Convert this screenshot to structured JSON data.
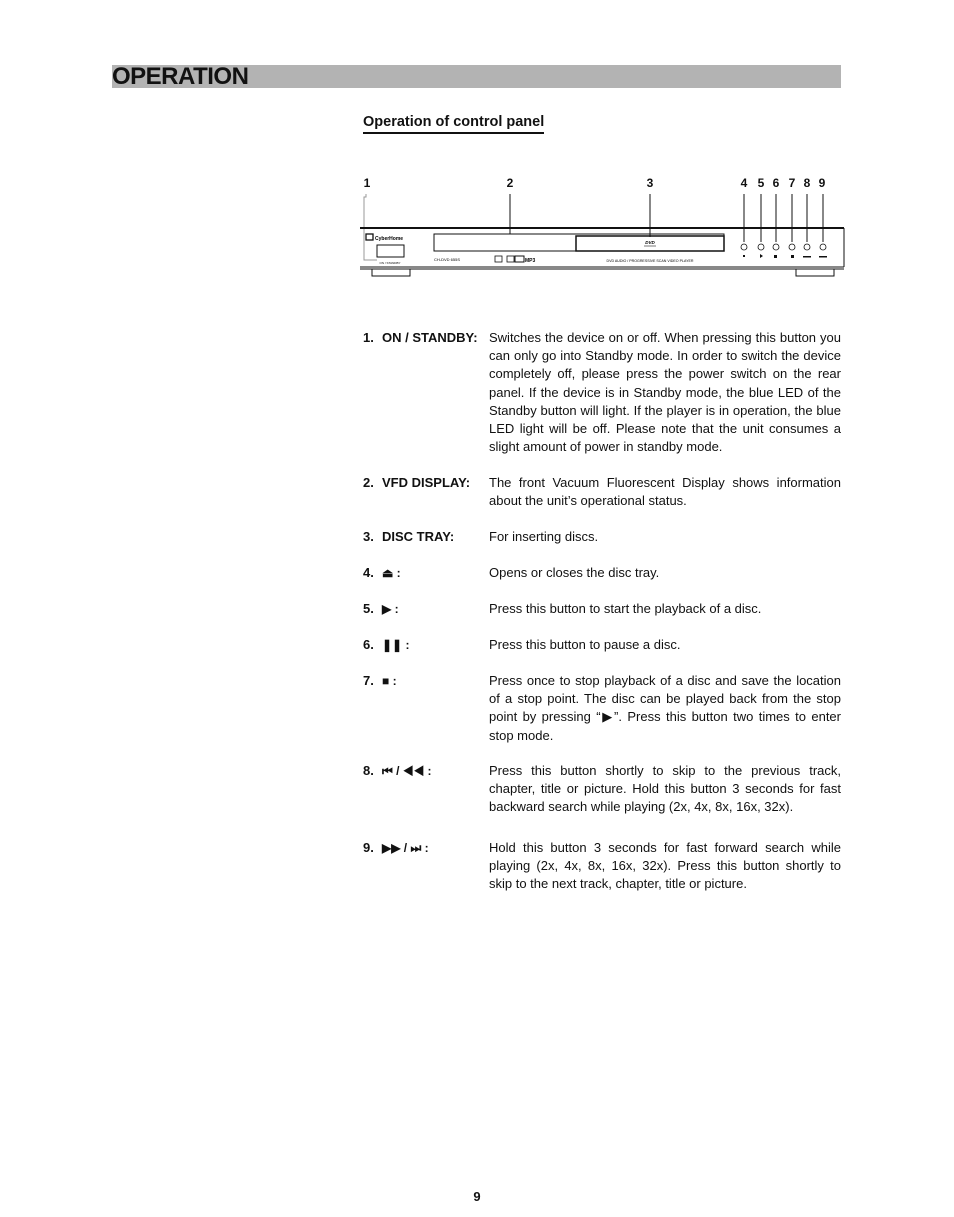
{
  "header": {
    "title": "OPERATION",
    "banner_color": "#b3b3b3"
  },
  "section": {
    "subtitle": "Operation of control panel"
  },
  "diagram": {
    "callouts": [
      "1",
      "2",
      "3",
      "4",
      "5",
      "6",
      "7",
      "8",
      "9"
    ],
    "brand": "CyberHome",
    "model": "CH-DVD 655S",
    "standby_label": "ON / STANDBY",
    "tray_logo": "DVD",
    "tray_caption": "DVD AUDIO / PROGRESSIVE SCAN VIDEO PLAYER",
    "format_logos": "MP3",
    "button_icons": [
      "eject-icon",
      "play-icon",
      "pause-icon",
      "stop-icon",
      "prev-rewind-icon",
      "forward-next-icon"
    ]
  },
  "entries": [
    {
      "number": "1.",
      "label": "ON / STANDBY:",
      "description": "Switches the device on or off. When pressing this button you can only go into Standby mode. In order to switch the device completely off, please press the power switch on the rear panel. If the device is in Standby mode, the blue LED of the Standby button will light. If the player is in operation, the blue LED light will be off. Please note that the unit consumes a slight amount of power in standby mode."
    },
    {
      "number": "2.",
      "label": "VFD DISPLAY:",
      "description": "The front Vacuum Fluorescent Display shows information about the unit’s operational status."
    },
    {
      "number": "3.",
      "label": "DISC TRAY:",
      "description": "For inserting discs."
    },
    {
      "number": "4.",
      "label": "⏏ :",
      "icon": "eject-icon",
      "description": "Opens or closes the disc tray."
    },
    {
      "number": "5.",
      "label": "▶ :",
      "icon": "play-icon",
      "description": "Press this button to start the playback of a disc."
    },
    {
      "number": "6.",
      "label": "❚❚ :",
      "icon": "pause-icon",
      "description": "Press this button to pause a disc."
    },
    {
      "number": "7.",
      "label": "■ :",
      "icon": "stop-icon",
      "description": "Press once to stop playback of a disc and save the location of a stop point. The disc can be played back from the stop point by pressing “▶”. Press this button two times to enter stop mode."
    },
    {
      "number": "8.",
      "label": "⏮ / ◀◀ :",
      "icon": "prev-rewind-icon",
      "description": "Press this button shortly to skip to the previous track, chapter, title or picture. Hold this button 3 seconds for fast backward search while playing (2x, 4x, 8x, 16x, 32x)."
    },
    {
      "number": "9.",
      "label": "▶▶ / ⏭ :",
      "icon": "forward-next-icon",
      "description": "Hold this button 3 seconds for fast forward search while playing (2x, 4x, 8x, 16x, 32x). Press this button shortly to skip to the next track, chapter, title or picture."
    }
  ],
  "footer": {
    "page_number": "9"
  }
}
